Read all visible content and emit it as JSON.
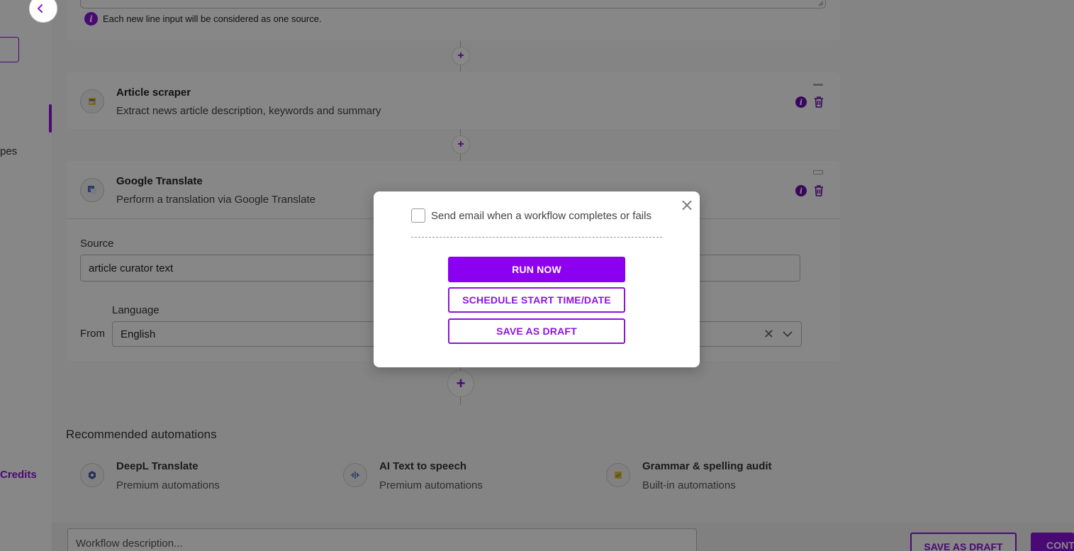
{
  "colors": {
    "accent": "#8b14d9",
    "primary_button": "#8b00f0"
  },
  "sidebar": {
    "partial_label": "pes",
    "credits_label": "Credits"
  },
  "workflow": {
    "top_card": {
      "info_text": "Each new line input will be considered as one source."
    },
    "steps": [
      {
        "title": "Article scraper",
        "description": "Extract news article description, keywords and summary"
      },
      {
        "title": "Google Translate",
        "description": "Perform a translation via Google Translate"
      }
    ],
    "google_translate_form": {
      "source_label": "Source",
      "source_value": "article curator text",
      "language_label": "Language",
      "from_label": "From",
      "from_value": "English"
    }
  },
  "recommended": {
    "title": "Recommended automations",
    "items": [
      {
        "name": "DeepL Translate",
        "category": "Premium automations",
        "icon": "deepl-icon"
      },
      {
        "name": "AI Text to speech",
        "category": "Premium automations",
        "icon": "audio-wave-icon"
      },
      {
        "name": "Grammar & spelling audit",
        "category": "Built-in automations",
        "icon": "grammar-icon"
      }
    ]
  },
  "bottom_bar": {
    "description_placeholder": "Workflow description...",
    "save_draft_label": "SAVE AS DRAFT",
    "continue_label": "CONT"
  },
  "modal": {
    "checkbox_label": "Send email when a workflow completes or fails",
    "checkbox_checked": false,
    "run_now_label": "RUN NOW",
    "schedule_label": "SCHEDULE START TIME/DATE",
    "save_draft_label": "SAVE AS DRAFT"
  }
}
